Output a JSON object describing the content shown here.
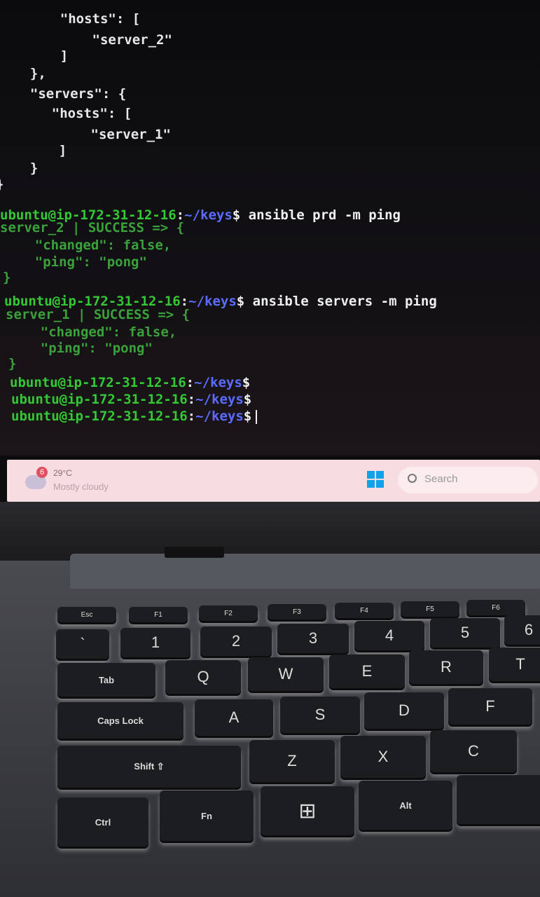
{
  "terminal": {
    "lines": [
      {
        "text": "    \"hosts\": ["
      },
      {
        "text": "        \"server_2\""
      },
      {
        "text": "    ]"
      },
      {
        "text": "  },"
      },
      {
        "text": "  \"servers\": {"
      },
      {
        "text": "    \"hosts\": ["
      },
      {
        "text": "        \"server_1\""
      },
      {
        "text": "    ]"
      },
      {
        "text": "  }"
      },
      {
        "text": "}"
      }
    ],
    "prompt_user": "ubuntu@ip-172-31-12-16",
    "prompt_sep": ":",
    "prompt_path": "~/keys",
    "prompt_dollar": "$",
    "cmd1": " ansible prd -m ping",
    "out1": [
      "server_2 | SUCCESS => {",
      "    \"changed\": false,",
      "    \"ping\": \"pong\"",
      "}"
    ],
    "cmd2": " ansible servers -m ping",
    "out2": [
      "server_1 | SUCCESS => {",
      "    \"changed\": false,",
      "    \"ping\": \"pong\"",
      "}"
    ]
  },
  "taskbar": {
    "weather_badge": "6",
    "temperature": "29°C",
    "condition": "Mostly cloudy",
    "search_label": "Search",
    "accent": "#12a2e8"
  },
  "keyboard": {
    "fn_row": [
      "Esc",
      "F1",
      "F2",
      "F3",
      "F4",
      "F5",
      "F6"
    ],
    "num_row": [
      "`",
      "1",
      "2",
      "3",
      "4",
      "5",
      "6"
    ],
    "q_row": [
      "Tab",
      "Q",
      "W",
      "E",
      "R",
      "T"
    ],
    "a_row": [
      "Caps Lock",
      "A",
      "S",
      "D",
      "F"
    ],
    "z_row": [
      "Shift ⇧",
      "Z",
      "X",
      "C"
    ],
    "bottom_row": [
      "Ctrl",
      "Fn",
      "⊞",
      "Alt"
    ]
  }
}
